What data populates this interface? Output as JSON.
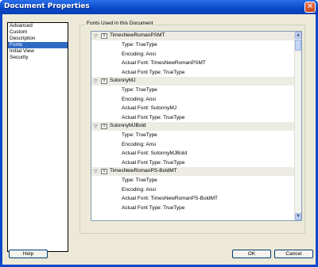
{
  "window": {
    "title": "Document Properties",
    "close_glyph": "✕"
  },
  "categories": [
    {
      "label": "Advanced",
      "selected": false
    },
    {
      "label": "Custom",
      "selected": false
    },
    {
      "label": "Description",
      "selected": false
    },
    {
      "label": "Fonts",
      "selected": true
    },
    {
      "label": "Initial View",
      "selected": false
    },
    {
      "label": "Security",
      "selected": false
    }
  ],
  "fonts_panel": {
    "group_label": "Fonts Used in this Document",
    "fonts": [
      {
        "name": "TimesNewRomanPSMT",
        "type": "Type: TrueType",
        "encoding": "Encoding: Ansi",
        "actual_font": "Actual Font: TimesNewRomanPSMT",
        "actual_type": "Actual Font Type: TrueType"
      },
      {
        "name": "SutonnyMJ",
        "type": "Type: TrueType",
        "encoding": "Encoding: Ansi",
        "actual_font": "Actual Font: SutonnyMJ",
        "actual_type": "Actual Font Type: TrueType"
      },
      {
        "name": "SutonnyMJBold",
        "type": "Type: TrueType",
        "encoding": "Encoding: Ansi",
        "actual_font": "Actual Font: SutonnyMJBold",
        "actual_type": "Actual Font Type: TrueType"
      },
      {
        "name": "TimesNewRomanPS-BoldMT",
        "type": "Type: TrueType",
        "encoding": "Encoding: Ansi",
        "actual_font": "Actual Font: TimesNewRomanPS-BoldMT",
        "actual_type": "Actual Font Type: TrueType"
      }
    ],
    "scrollbar": {
      "position": 0.03
    }
  },
  "buttons": {
    "help": "Help",
    "ok": "OK",
    "cancel": "Cancel"
  },
  "colors": {
    "titlebar": "#0848c8",
    "selection": "#316ac5",
    "dialog_bg": "#ece9d8"
  },
  "icons": {
    "collapse": "chevron-down-icon",
    "font": "truetype-font-icon",
    "close": "close-icon"
  }
}
